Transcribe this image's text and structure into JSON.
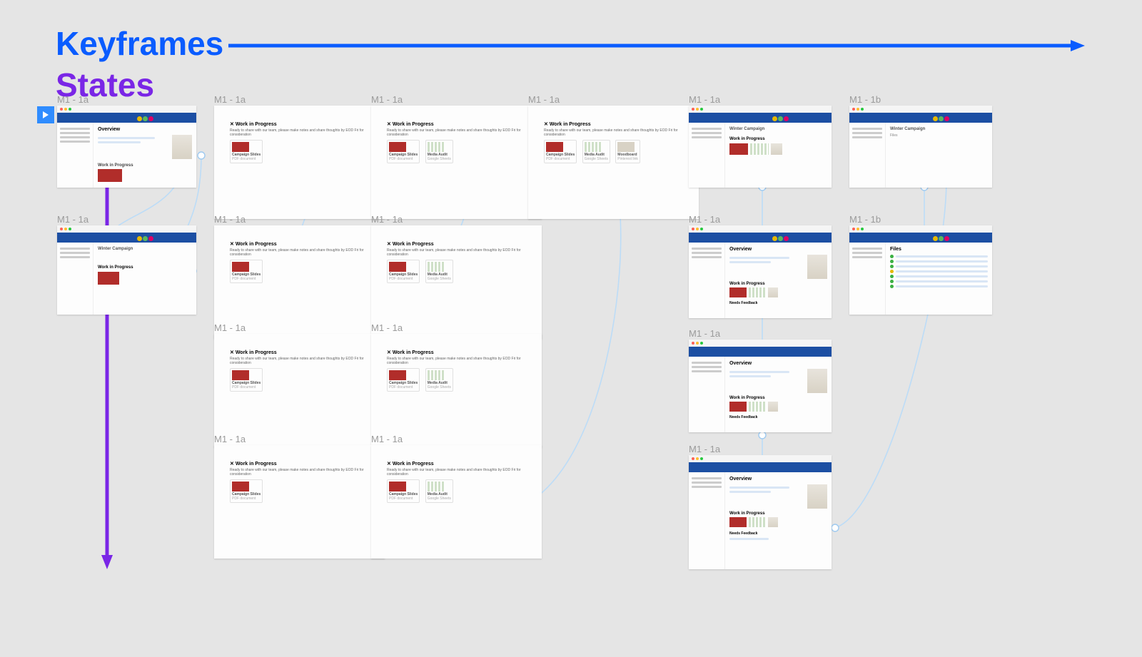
{
  "headers": {
    "keyframes": "Keyframes",
    "states": "States"
  },
  "labels": {
    "l_0_0": "M1 - 1a",
    "l_0_1": "M1 - 1a",
    "l_0_2": "M1 - 1a",
    "l_0_3": "M1 - 1a",
    "l_0_4": "M1 - 1a",
    "l_0_5": "M1 - 1b",
    "l_1_0": "M1 - 1a",
    "l_1_1": "M1 - 1a",
    "l_1_2": "M1 - 1a",
    "l_1_4": "M1 - 1a",
    "l_1_5": "M1 - 1b",
    "l_2_1": "M1 - 1a",
    "l_2_2": "M1 - 1a",
    "l_2_4": "M1 - 1a",
    "l_3_1": "M1 - 1a",
    "l_3_2": "M1 - 1a",
    "l_3_4": "M1 - 1a"
  },
  "thumb": {
    "overview": "Overview",
    "files": "Files",
    "wip": "Work in Progress",
    "sub": "Ready to share with our team, please make notes and share thoughts by EOD Fri for consideration",
    "campaign": "Campaign Slides",
    "campaign_sub": "PDF document",
    "media": "Media Audit",
    "media_sub": "Google Sheets",
    "mood": "Moodboard",
    "mood_sub": "Pinterest link",
    "winter": "Winter Campaign",
    "needs": "Needs Feedback"
  },
  "colors": {
    "keyframes": "#0a5cff",
    "states": "#7a26e6",
    "connector": "#bcdcf7",
    "frame_bg": "#fdfdfd",
    "app_blue": "#1c4fa3"
  }
}
